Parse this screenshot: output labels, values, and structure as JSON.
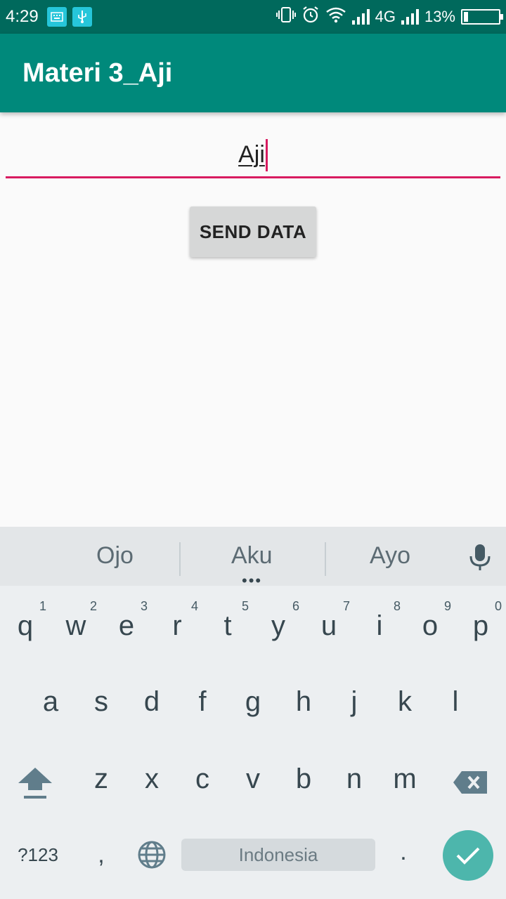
{
  "status_bar": {
    "time": "4:29",
    "network": "4G",
    "battery": "13%",
    "battery_level": 0.13,
    "icons": [
      "keyboard-icon",
      "usb-icon",
      "vibrate-icon",
      "alarm-icon",
      "wifi-icon",
      "signal-icon",
      "signal-icon",
      "battery-charging-icon"
    ]
  },
  "app_bar": {
    "title": "Materi 3_Aji"
  },
  "form": {
    "input_value": "Aji",
    "send_button": "SEND DATA"
  },
  "keyboard": {
    "suggestions": [
      "Ojo",
      "Aku",
      "Ayo"
    ],
    "row1": [
      {
        "k": "q",
        "h": "1"
      },
      {
        "k": "w",
        "h": "2"
      },
      {
        "k": "e",
        "h": "3"
      },
      {
        "k": "r",
        "h": "4"
      },
      {
        "k": "t",
        "h": "5"
      },
      {
        "k": "y",
        "h": "6"
      },
      {
        "k": "u",
        "h": "7"
      },
      {
        "k": "i",
        "h": "8"
      },
      {
        "k": "o",
        "h": "9"
      },
      {
        "k": "p",
        "h": "0"
      }
    ],
    "row2": [
      "a",
      "s",
      "d",
      "f",
      "g",
      "h",
      "j",
      "k",
      "l"
    ],
    "row3": [
      "z",
      "x",
      "c",
      "v",
      "b",
      "n",
      "m"
    ],
    "symbols_label": "?123",
    "comma_label": ",",
    "space_label": "Indonesia",
    "period_label": "."
  },
  "colors": {
    "status_bar": "#00695c",
    "app_bar": "#00897b",
    "accent": "#d81b60",
    "enter_key": "#4db6ac"
  }
}
